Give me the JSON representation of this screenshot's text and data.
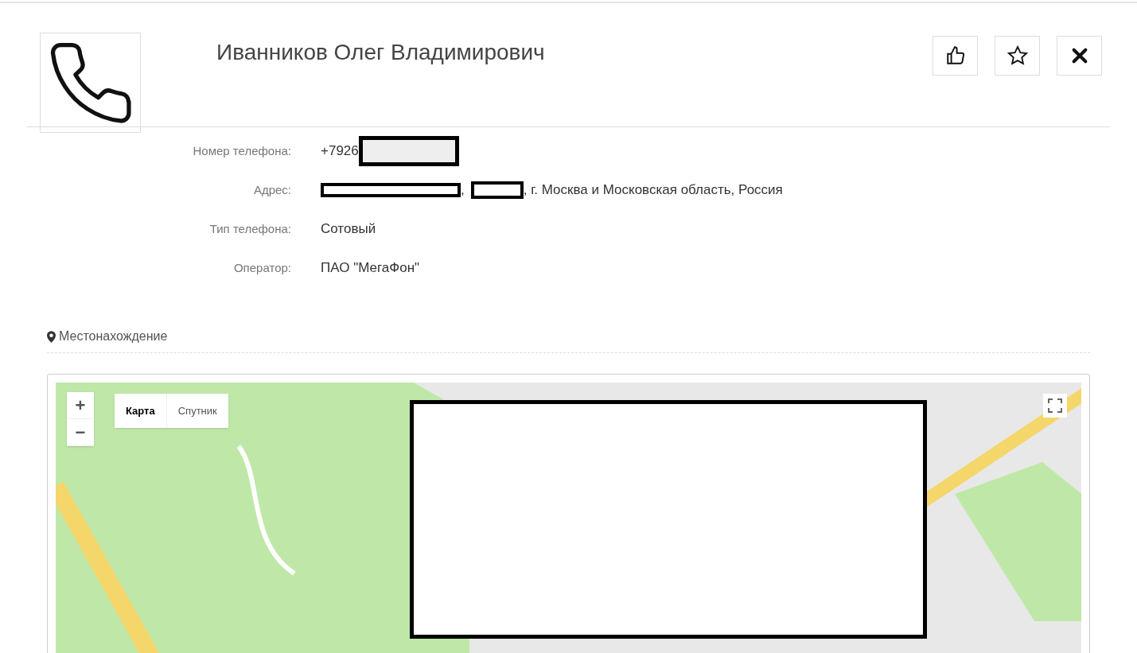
{
  "contact": {
    "name": "Иванников Олег Владимирович"
  },
  "actions": [
    {
      "kind": "like"
    },
    {
      "kind": "favorite"
    },
    {
      "kind": "close"
    }
  ],
  "fields": [
    {
      "label": "Номер телефона:",
      "parts": [
        {
          "kind": "text",
          "text": "+7926"
        },
        {
          "kind": "redacted_block"
        }
      ]
    },
    {
      "label": "Адрес:",
      "parts": [
        {
          "kind": "redacted_line_long"
        },
        {
          "kind": "text",
          "text": ","
        },
        {
          "kind": "redacted_line_short"
        },
        {
          "kind": "text",
          "text": ", г. Москва и Московская область, Россия"
        }
      ]
    },
    {
      "label": "Тип телефона:",
      "parts": [
        {
          "kind": "text",
          "text": "Сотовый"
        }
      ]
    },
    {
      "label": "Оператор:",
      "parts": [
        {
          "kind": "text",
          "text": "ПАО \"МегаФон\""
        }
      ]
    }
  ],
  "location": {
    "title": "Местонахождение",
    "zoom": [
      "+",
      "−"
    ],
    "map_types": [
      {
        "label": "Карта",
        "selected": true
      },
      {
        "label": "Спутник",
        "selected": false
      }
    ]
  }
}
